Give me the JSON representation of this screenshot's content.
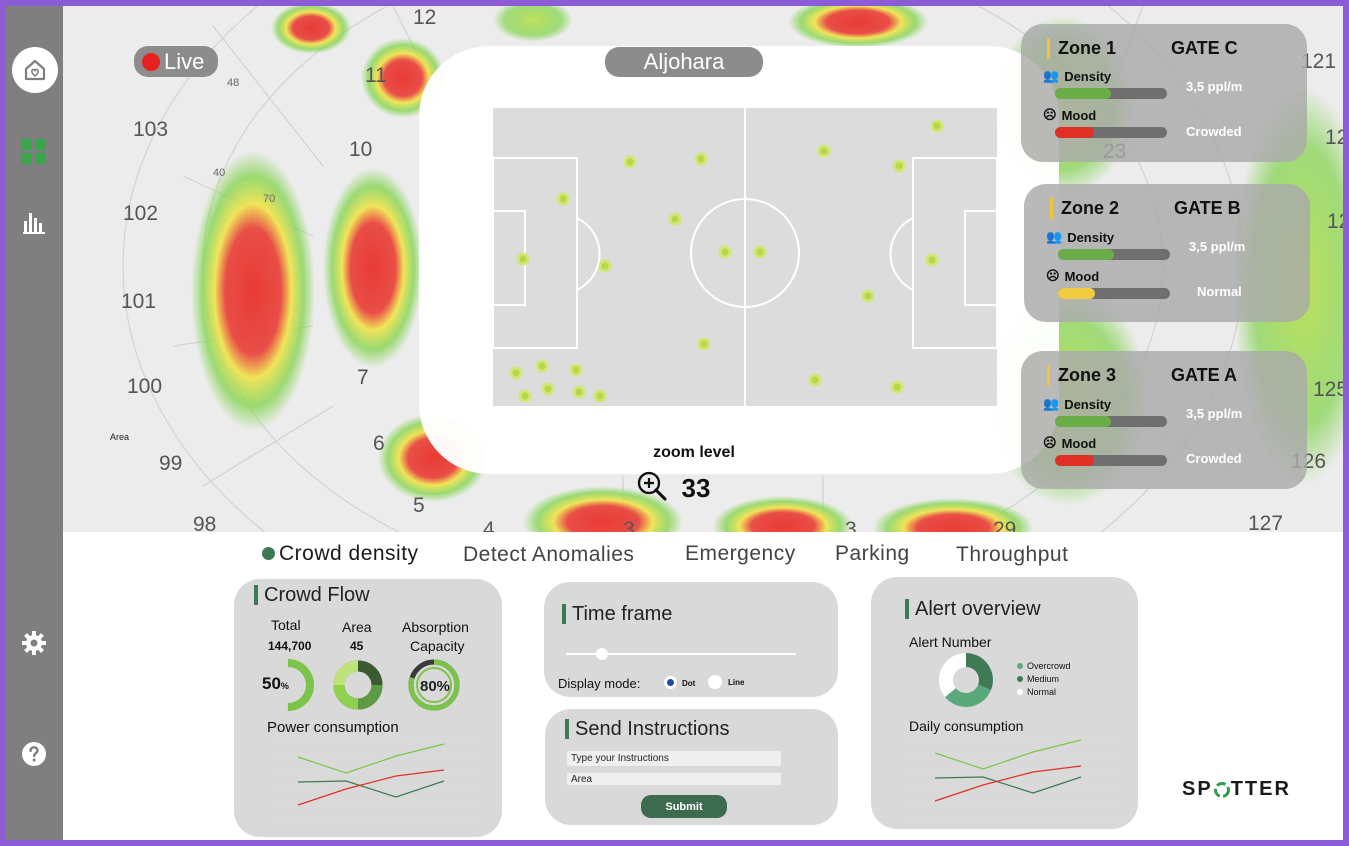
{
  "sidebar": {
    "items": [
      {
        "icon": "home-heart-icon"
      },
      {
        "icon": "dashboard-grid-icon"
      },
      {
        "icon": "bar-chart-icon"
      },
      {
        "icon": "gear-icon"
      },
      {
        "icon": "help-icon"
      }
    ]
  },
  "header": {
    "live_label": "Live",
    "venue": "Aljohara"
  },
  "map": {
    "section_labels": [
      "12",
      "11",
      "10",
      "7",
      "6",
      "5",
      "103",
      "102",
      "101",
      "100",
      "99",
      "98",
      "4",
      "3",
      "3",
      "29",
      "127",
      "126",
      "125",
      "121",
      "12",
      "12",
      "23"
    ],
    "small_labels": [
      "48",
      "40",
      "70",
      "Area"
    ],
    "zoom_label": "zoom level",
    "zoom_value": "33"
  },
  "zones": [
    {
      "title": "Zone 1",
      "gate": "GATE C",
      "density_label": "Density",
      "density_value": "3,5 ppl/m",
      "density_level": 0.5,
      "mood_label": "Mood",
      "mood_value": "Crowded",
      "mood_level": 0.35,
      "mood_color": "#e03025"
    },
    {
      "title": "Zone 2",
      "gate": "GATE B",
      "density_label": "Density",
      "density_value": "3,5 ppl/m",
      "density_level": 0.5,
      "mood_label": "Mood",
      "mood_value": "Normal",
      "mood_level": 0.33,
      "mood_color": "#f2cd43"
    },
    {
      "title": "Zone 3",
      "gate": "GATE A",
      "density_label": "Density",
      "density_value": "3,5 ppl/m",
      "density_level": 0.5,
      "mood_label": "Mood",
      "mood_value": "Crowded",
      "mood_level": 0.35,
      "mood_color": "#e03025"
    }
  ],
  "tabs": [
    {
      "label": "Crowd density",
      "active": true
    },
    {
      "label": "Detect  Anomalies",
      "active": false
    },
    {
      "label": "Emergency",
      "active": false
    },
    {
      "label": "Parking",
      "active": false
    },
    {
      "label": "Throughput",
      "active": false
    }
  ],
  "crowd_flow": {
    "title": "Crowd Flow",
    "total_label": "Total",
    "total_value": "144,700",
    "total_percent": "50",
    "total_percent_unit": "%",
    "total_fraction": 0.5,
    "area_label": "Area",
    "area_value": "45",
    "absorption_label_1": "Absorption",
    "absorption_label_2": "Capacity",
    "absorption_value": "80%",
    "absorption_fraction": 0.8,
    "power_label": "Power consumption"
  },
  "time_frame": {
    "title": "Time frame",
    "display_mode_label": "Display mode:",
    "option_dot": "Dot",
    "option_line": "Line",
    "selected": "Dot"
  },
  "instructions": {
    "title": "Send Instructions",
    "instruction_placeholder": "Type your Instructions",
    "area_placeholder": "Area",
    "submit_label": "Submit"
  },
  "alerts": {
    "title": "Alert overview",
    "alert_number_label": "Alert Number",
    "legend": [
      {
        "label": "Overcrowd",
        "color": "#5aa97a"
      },
      {
        "label": "Medium",
        "color": "#3f7a55"
      },
      {
        "label": "Normal",
        "color": "#ffffff"
      }
    ],
    "daily_label": "Daily consumption"
  },
  "brand": {
    "prefix": "SP",
    "suffix": "TTER"
  },
  "colors": {
    "sidebar": "#7f7f7f",
    "accent_green": "#3c7a53",
    "danger": "#e8231f",
    "warning": "#f2c531"
  }
}
